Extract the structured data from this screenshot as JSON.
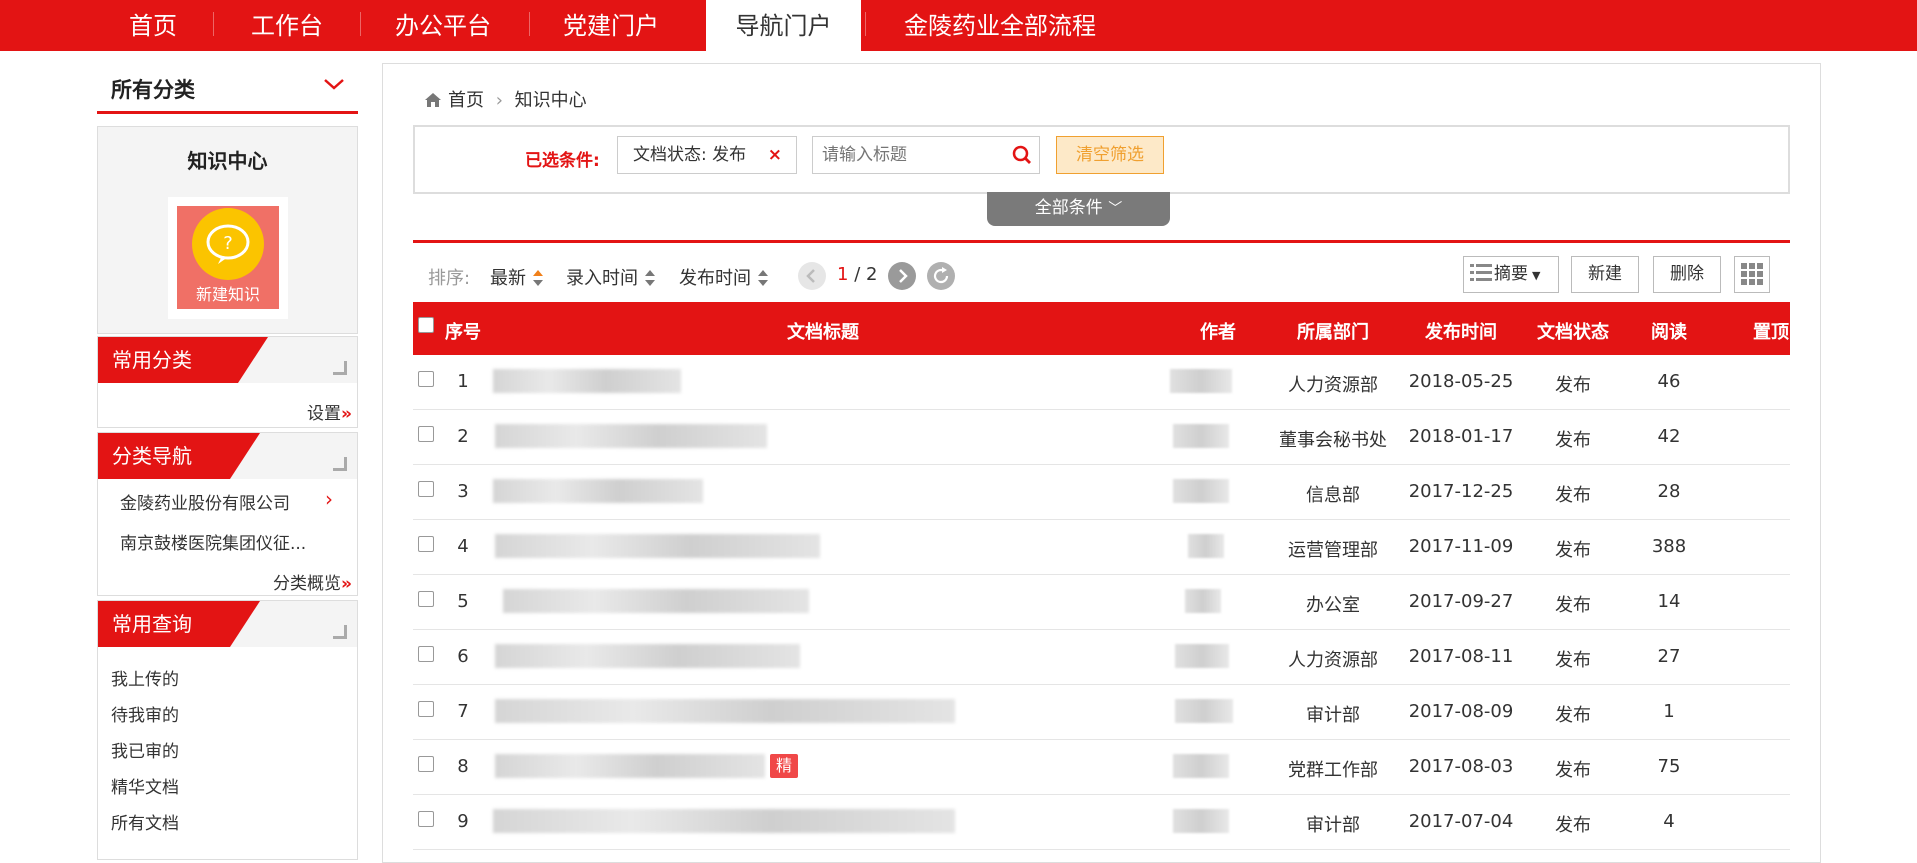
{
  "nav": {
    "items": [
      {
        "label": "首页"
      },
      {
        "label": "工作台"
      },
      {
        "label": "办公平台"
      },
      {
        "label": "党建门户"
      },
      {
        "label": "导航门户"
      },
      {
        "label": "金陵药业全部流程"
      }
    ],
    "active_index": 4
  },
  "sidebar": {
    "category_title": "所有分类",
    "knowledge_title": "知识中心",
    "new_knowledge_label": "新建知识",
    "common_category": {
      "title": "常用分类",
      "settings_link": "设置"
    },
    "category_nav": {
      "title": "分类导航",
      "items": [
        "金陵药业股份有限公司",
        "南京鼓楼医院集团仪征..."
      ],
      "overview_link": "分类概览"
    },
    "common_query": {
      "title": "常用查询",
      "items": [
        "我上传的",
        "待我审的",
        "我已审的",
        "精华文档",
        "所有文档"
      ]
    }
  },
  "breadcrumb": {
    "home": "首页",
    "current": "知识中心"
  },
  "filter": {
    "label": "已选条件:",
    "tag": "文档状态: 发布",
    "tag_close": "×",
    "search_placeholder": "请输入标题",
    "clear_label": "清空筛选",
    "all_conditions": "全部条件"
  },
  "toolbar": {
    "sort_label": "排序:",
    "sort_options": [
      "最新",
      "录入时间",
      "发布时间"
    ],
    "page_current": "1",
    "page_sep": "/",
    "page_total": "2",
    "view_label": "摘要",
    "new_label": "新建",
    "delete_label": "删除"
  },
  "table": {
    "headers": {
      "index": "序号",
      "title": "文档标题",
      "author": "作者",
      "dept": "所属部门",
      "date": "发布时间",
      "status": "文档状态",
      "reads": "阅读",
      "top": "置顶"
    },
    "rows": [
      {
        "index": "1",
        "dept": "人力资源部",
        "date": "2018-05-25",
        "status": "发布",
        "reads": "46"
      },
      {
        "index": "2",
        "dept": "董事会秘书处",
        "date": "2018-01-17",
        "status": "发布",
        "reads": "42"
      },
      {
        "index": "3",
        "dept": "信息部",
        "date": "2017-12-25",
        "status": "发布",
        "reads": "28"
      },
      {
        "index": "4",
        "dept": "运营管理部",
        "date": "2017-11-09",
        "status": "发布",
        "reads": "388"
      },
      {
        "index": "5",
        "dept": "办公室",
        "date": "2017-09-27",
        "status": "发布",
        "reads": "14"
      },
      {
        "index": "6",
        "dept": "人力资源部",
        "date": "2017-08-11",
        "status": "发布",
        "reads": "27"
      },
      {
        "index": "7",
        "dept": "审计部",
        "date": "2017-08-09",
        "status": "发布",
        "reads": "1"
      },
      {
        "index": "8",
        "dept": "党群工作部",
        "date": "2017-08-03",
        "status": "发布",
        "reads": "75",
        "badge": "精"
      },
      {
        "index": "9",
        "dept": "审计部",
        "date": "2017-07-04",
        "status": "发布",
        "reads": "4"
      }
    ]
  },
  "colors": {
    "brand_red": "#e31414",
    "clear_bg": "#fde9c8",
    "clear_border": "#f0a030"
  }
}
